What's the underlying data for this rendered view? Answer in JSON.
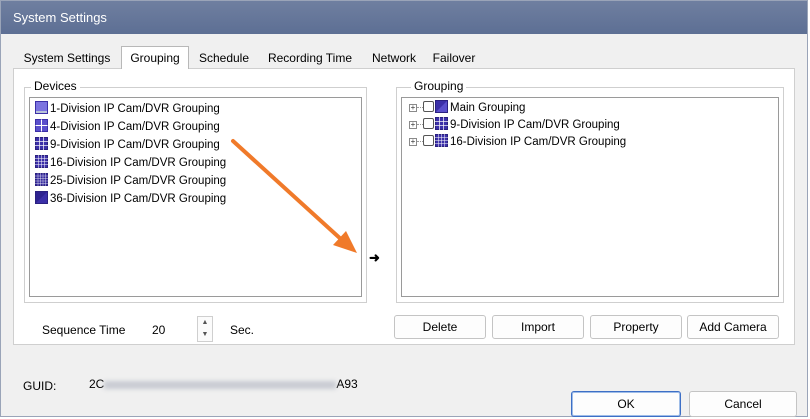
{
  "window": {
    "title": "System Settings"
  },
  "tabs": [
    {
      "label": "System Settings",
      "active": false
    },
    {
      "label": "Grouping",
      "active": true
    },
    {
      "label": "Schedule",
      "active": false
    },
    {
      "label": "Recording Time",
      "active": false
    },
    {
      "label": "Network",
      "active": false
    },
    {
      "label": "Failover",
      "active": false
    }
  ],
  "devices": {
    "label": "Devices",
    "items": [
      {
        "label": "1-Division IP Cam/DVR Grouping",
        "icon": "grid-1-icon"
      },
      {
        "label": "4-Division IP Cam/DVR Grouping",
        "icon": "grid-4-icon"
      },
      {
        "label": "9-Division IP Cam/DVR Grouping",
        "icon": "grid-9-icon"
      },
      {
        "label": "16-Division IP Cam/DVR Grouping",
        "icon": "grid-16-icon"
      },
      {
        "label": "25-Division IP Cam/DVR Grouping",
        "icon": "grid-25-icon"
      },
      {
        "label": "36-Division IP Cam/DVR Grouping",
        "icon": "grid-36-icon"
      }
    ]
  },
  "transfer": {
    "icon": "right-arrow-icon",
    "glyph": "➜"
  },
  "grouping": {
    "label": "Grouping",
    "items": [
      {
        "label": "Main Grouping",
        "icon": "grid-1-icon"
      },
      {
        "label": "9-Division IP Cam/DVR Grouping",
        "icon": "grid-9-icon"
      },
      {
        "label": "16-Division IP Cam/DVR Grouping",
        "icon": "grid-16-icon"
      }
    ],
    "buttons": {
      "delete": "Delete",
      "import": "Import",
      "property": "Property",
      "add_camera": "Add Camera"
    }
  },
  "sequence": {
    "label": "Sequence Time",
    "value": "20",
    "unit": "Sec."
  },
  "guid": {
    "label": "GUID:",
    "prefix": "2C",
    "suffix": "A93"
  },
  "footer": {
    "ok": "OK",
    "cancel": "Cancel"
  },
  "colors": {
    "titlebar": "#5d6f94",
    "device_icon": "#3b2fa8",
    "device_icon_light": "#7b73e0",
    "annotation_arrow": "#f07a2a",
    "primary_border": "#3d6fc6"
  }
}
